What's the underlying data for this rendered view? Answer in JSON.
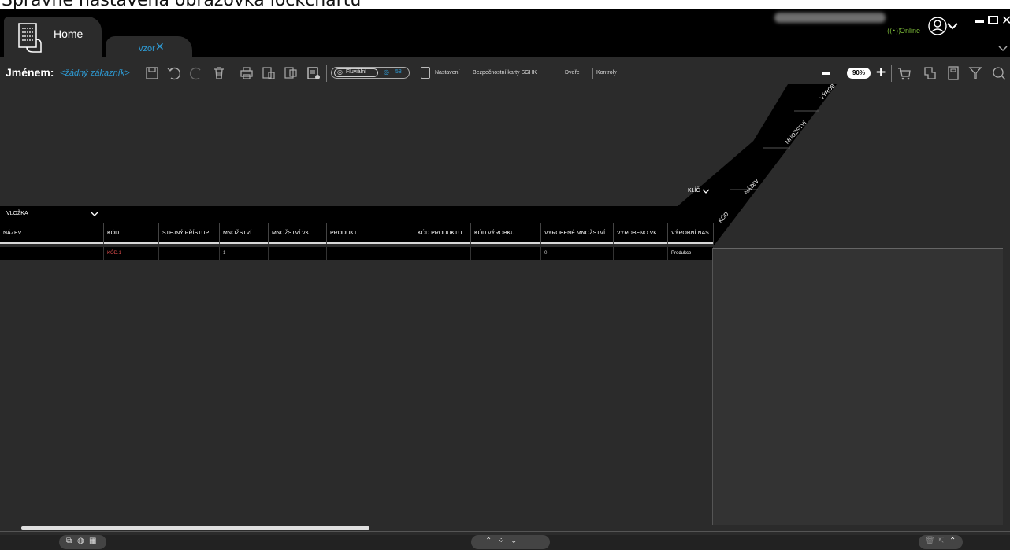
{
  "caption": "Správně nastavená obrazovka lockchartu",
  "tabs": {
    "home_label": "Home",
    "doc_label": "vzor",
    "doc_close": "✕"
  },
  "status": {
    "online": "Online"
  },
  "toolbar": {
    "by_name_label": "Jménem:",
    "customer_value": "<žádný zákazník>",
    "filter_left": "Fluviální",
    "filter_right": "58",
    "menu": [
      "Nastavení",
      "Bezpečnostní karty SGHK",
      "Dveře",
      "Kontroly"
    ],
    "zoom": "90%"
  },
  "diagonal_headers": [
    "VÝROB",
    "MNOŽSTVÍ",
    "NÁZEV",
    "KÓD"
  ],
  "key_label": "KLÍČ",
  "group": {
    "label": "VLOŽKA"
  },
  "grid": {
    "columns": [
      "NÁZEV",
      "KÓD",
      "STEJNÝ PŘÍSTUP...",
      "MNOŽSTVÍ",
      "MNOŽSTVÍ VK",
      "PRODUKT",
      "KÓD PRODUKTU",
      "KÓD VÝROBKU",
      "VYROBENÉ MNOŽSTVÍ",
      "VYROBENO VK",
      "VÝROBNÍ NAS"
    ],
    "rows": [
      [
        "",
        "KÓD.1",
        "",
        "1",
        "",
        "",
        "",
        "",
        "0",
        "",
        "Produkce"
      ]
    ]
  },
  "colors": {
    "accent": "#2e9cd6",
    "code_red": "#d94a4a",
    "online_green": "#7fbf3a"
  }
}
